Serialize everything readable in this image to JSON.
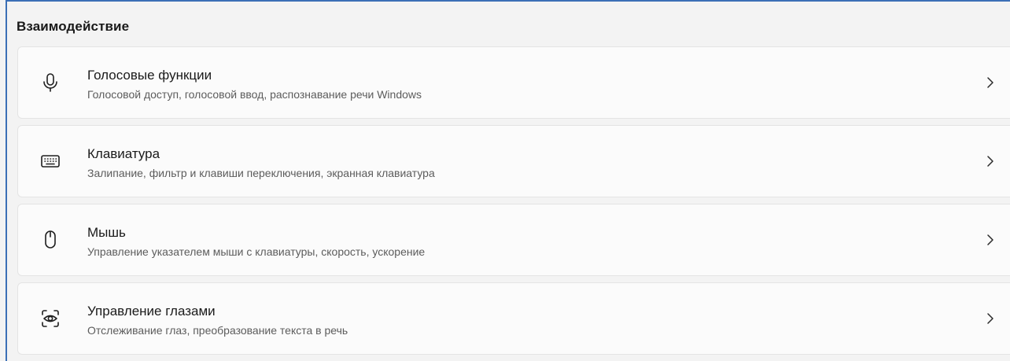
{
  "section": {
    "title": "Взаимодействие"
  },
  "items": [
    {
      "label": "Голосовые функции",
      "description": "Голосовой доступ, голосовой ввод, распознавание речи Windows",
      "icon": "microphone-icon"
    },
    {
      "label": "Клавиатура",
      "description": "Залипание, фильтр и клавиши переключения, экранная клавиатура",
      "icon": "keyboard-icon"
    },
    {
      "label": "Мышь",
      "description": "Управление указателем мыши с клавиатуры, скорость, ускорение",
      "icon": "mouse-icon"
    },
    {
      "label": "Управление глазами",
      "description": "Отслеживание глаз, преобразование текста в речь",
      "icon": "eye-control-icon"
    }
  ],
  "colors": {
    "background": "#f3f3f3",
    "card": "#fbfbfb",
    "card_border": "#e4e4e4",
    "frame_accent": "#3b6fb6"
  }
}
